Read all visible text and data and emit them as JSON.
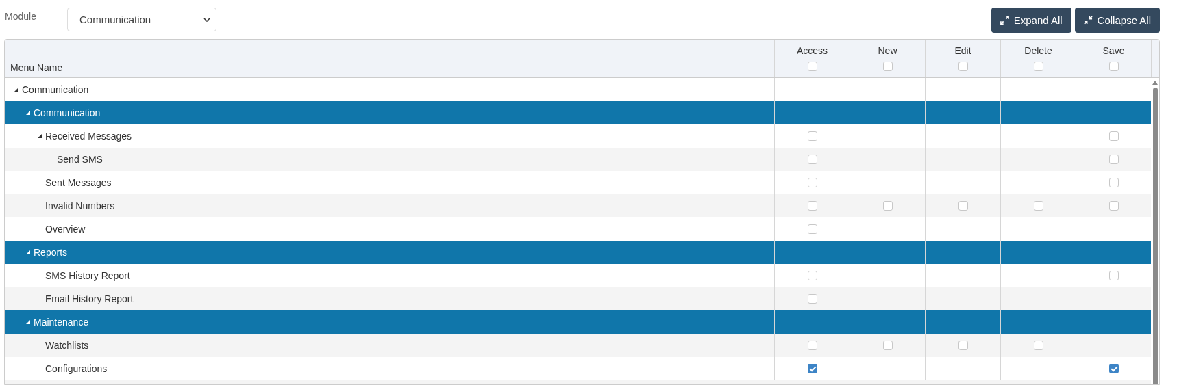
{
  "filter": {
    "label": "Module",
    "value": "Communication"
  },
  "buttons": [
    {
      "kind": "expand",
      "label": "Expand All"
    },
    {
      "kind": "collapse",
      "label": "Collapse All"
    }
  ],
  "table": {
    "name_column": "Menu Name",
    "columns": [
      {
        "label": "Access",
        "checked": false
      },
      {
        "label": "New",
        "checked": false
      },
      {
        "label": "Edit",
        "checked": false
      },
      {
        "label": "Delete",
        "checked": false
      },
      {
        "label": "Save",
        "checked": false
      }
    ],
    "rows": [
      {
        "name": "Communication",
        "expanded": true,
        "children": [
          {
            "name": "Communication",
            "kind": "section",
            "expanded": true,
            "children": [
              {
                "name": "Received Messages",
                "expanded": true,
                "access": {
                  "checked": false
                },
                "save": {
                  "checked": false
                },
                "children": [
                  {
                    "name": "Send SMS",
                    "access": {
                      "checked": false
                    },
                    "save": {
                      "checked": false
                    }
                  }
                ]
              },
              {
                "name": "Sent Messages",
                "access": {
                  "checked": false
                },
                "save": {
                  "checked": false
                }
              },
              {
                "name": "Invalid Numbers",
                "access": {
                  "checked": false
                },
                "new": {
                  "checked": false
                },
                "edit": {
                  "checked": false
                },
                "delete": {
                  "checked": false
                },
                "save": {
                  "checked": false
                }
              },
              {
                "name": "Overview",
                "access": {
                  "checked": false
                }
              }
            ]
          },
          {
            "name": "Reports",
            "kind": "section",
            "expanded": true,
            "children": [
              {
                "name": "SMS History Report",
                "access": {
                  "checked": false
                },
                "save": {
                  "checked": false
                }
              },
              {
                "name": "Email History Report",
                "access": {
                  "checked": false
                }
              }
            ]
          },
          {
            "name": "Maintenance",
            "kind": "section",
            "expanded": true,
            "children": [
              {
                "name": "Watchlists",
                "access": {
                  "checked": false
                },
                "new": {
                  "checked": false
                },
                "edit": {
                  "checked": false
                },
                "delete": {
                  "checked": false
                }
              },
              {
                "name": "Configurations",
                "access": {
                  "checked": true
                },
                "save": {
                  "checked": true
                }
              }
            ]
          }
        ]
      }
    ]
  }
}
